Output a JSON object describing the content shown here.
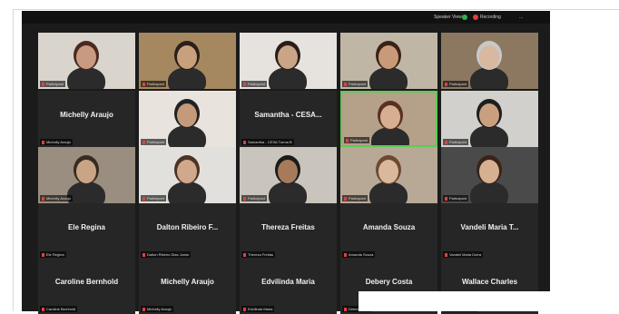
{
  "topbar": {
    "view_label": "Speaker View",
    "recording_label": "Recording",
    "options_label": "...",
    "colors": {
      "green": "#2fb14b",
      "red": "#e04040"
    }
  },
  "tiles": [
    {
      "name": "",
      "label": "Participant",
      "video": true,
      "bg": "#d9d4cc",
      "skin": "#c89a80",
      "hair": "#4a2a20"
    },
    {
      "name": "",
      "label": "Participant",
      "video": true,
      "bg": "#a58860",
      "skin": "#c9a07c",
      "hair": "#2b1f18"
    },
    {
      "name": "",
      "label": "Participant",
      "video": true,
      "bg": "#e6e2de",
      "skin": "#caa486",
      "hair": "#2a1d18"
    },
    {
      "name": "",
      "label": "Participant",
      "video": true,
      "bg": "#bfb6a6",
      "skin": "#c99a7a",
      "hair": "#3a2218"
    },
    {
      "name": "",
      "label": "Participant",
      "video": true,
      "bg": "#8c7860",
      "skin": "#d8b8a0",
      "hair": "#c8c8c8"
    },
    {
      "name": "Michelly Araujo",
      "label": "Michelly Araujo",
      "video": false
    },
    {
      "name": "",
      "label": "Participant",
      "video": true,
      "bg": "#e8e4dd",
      "skin": "#c49a7a",
      "hair": "#222222"
    },
    {
      "name": "Samantha - CESA...",
      "label": "Samantha - CESA Turma B",
      "video": false
    },
    {
      "name": "",
      "label": "Participant",
      "video": true,
      "active": true,
      "bg": "#b5a08a",
      "skin": "#d8ae90",
      "hair": "#5a3020"
    },
    {
      "name": "",
      "label": "Participant",
      "video": true,
      "bg": "#d2d0cc",
      "skin": "#c8a080",
      "hair": "#1e1e1e"
    },
    {
      "name": "",
      "label": "Michelly Araujo",
      "video": true,
      "bg": "#9a8e80",
      "skin": "#c9a586",
      "hair": "#3a2a20"
    },
    {
      "name": "",
      "label": "Participant",
      "video": true,
      "bg": "#e2e0dc",
      "skin": "#d0a88c",
      "hair": "#4b3325"
    },
    {
      "name": "",
      "label": "Participant",
      "video": true,
      "bg": "#c9c5bd",
      "skin": "#a77a5c",
      "hair": "#1b1b1b"
    },
    {
      "name": "",
      "label": "Participant",
      "video": true,
      "bg": "#b8a896",
      "skin": "#d9b89c",
      "hair": "#6b4a30"
    },
    {
      "name": "",
      "label": "Participant",
      "video": true,
      "bg": "#4a4a4a",
      "skin": "#d6b090",
      "hair": "#3a2418"
    },
    {
      "name": "Ele Regina",
      "label": "Ele Regina",
      "video": false
    },
    {
      "name": "Dalton Ribeiro F...",
      "label": "Dalton Ribeiro Dias Junior",
      "video": false
    },
    {
      "name": "Thereza Freitas",
      "label": "Thereza Freitas",
      "video": false
    },
    {
      "name": "Amanda Souza",
      "label": "Amanda Souza",
      "video": false
    },
    {
      "name": "Vandeli Maria T...",
      "label": "Vandeli Maria Dutra",
      "video": false
    },
    {
      "name": "Caroline Bernhold",
      "label": "Caroline Bernhold",
      "video": false
    },
    {
      "name": "Michelly Araujo",
      "label": "Michelly Araujo",
      "video": false
    },
    {
      "name": "Edvilinda Maria",
      "label": "Edvilinda Maria",
      "video": false
    },
    {
      "name": "Debery Costa",
      "label": "Debery Costa",
      "video": false
    },
    {
      "name": "Wallace Charles",
      "label": "Wallace Charles",
      "video": false
    }
  ]
}
